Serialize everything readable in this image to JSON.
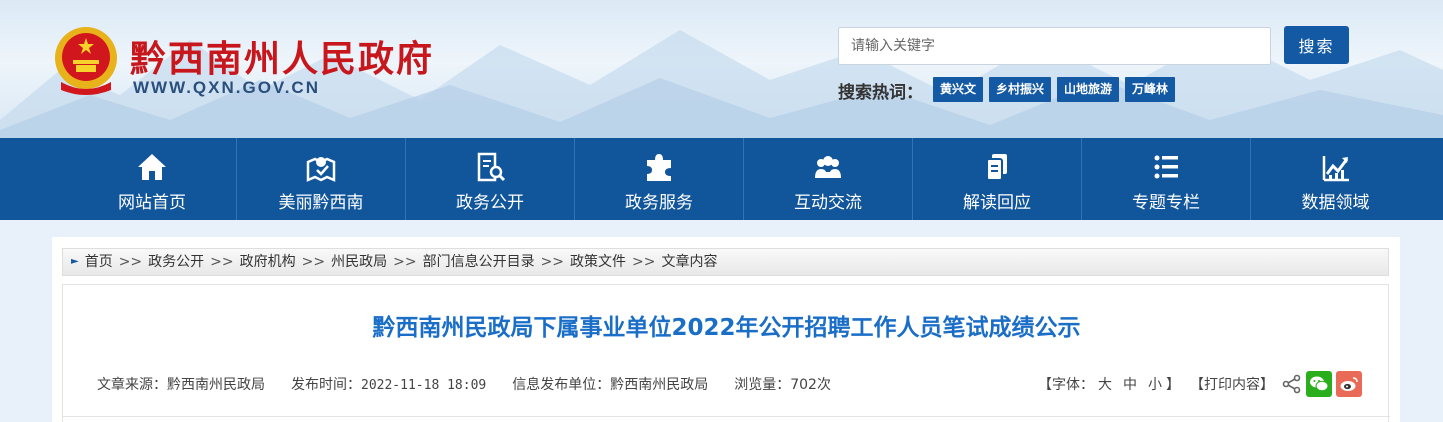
{
  "header": {
    "site_title": "黔西南州人民政府",
    "site_url": "WWW.QXN.GOV.CN",
    "search_placeholder": "请输入关键字",
    "search_button": "搜索",
    "hot_label": "搜索热词：",
    "hot_tags": [
      "黄兴文",
      "乡村振兴",
      "山地旅游",
      "万峰林"
    ]
  },
  "nav": {
    "items": [
      {
        "label": "网站首页",
        "icon": "home-icon"
      },
      {
        "label": "美丽黔西南",
        "icon": "map-pin-icon"
      },
      {
        "label": "政务公开",
        "icon": "document-search-icon"
      },
      {
        "label": "政务服务",
        "icon": "puzzle-icon"
      },
      {
        "label": "互动交流",
        "icon": "people-icon"
      },
      {
        "label": "解读回应",
        "icon": "file-copy-icon"
      },
      {
        "label": "专题专栏",
        "icon": "list-icon"
      },
      {
        "label": "数据领域",
        "icon": "chart-icon"
      }
    ]
  },
  "breadcrumb": [
    "首页",
    "政务公开",
    "政府机构",
    "州民政局",
    "部门信息公开目录",
    "政策文件",
    "文章内容"
  ],
  "breadcrumb_sep": ">>",
  "article": {
    "title": "黔西南州民政局下属事业单位2022年公开招聘工作人员笔试成绩公示",
    "source": "文章来源：黔西南州民政局",
    "publish_time_label": "发布时间：",
    "publish_time": "2022-11-18 18:09",
    "publisher": "信息发布单位：黔西南州民政局",
    "views": "浏览量：702次"
  },
  "tools": {
    "font_label": "【字体：",
    "font_large": "大",
    "font_medium": "中",
    "font_small": "小",
    "font_end": "】",
    "print": "【打印内容】"
  },
  "colors": {
    "brand_blue": "#11559b",
    "title_red": "#c8161d",
    "article_title": "#1a6ec7",
    "wechat_green": "#2aae1c",
    "weibo_red": "#e96b57"
  }
}
